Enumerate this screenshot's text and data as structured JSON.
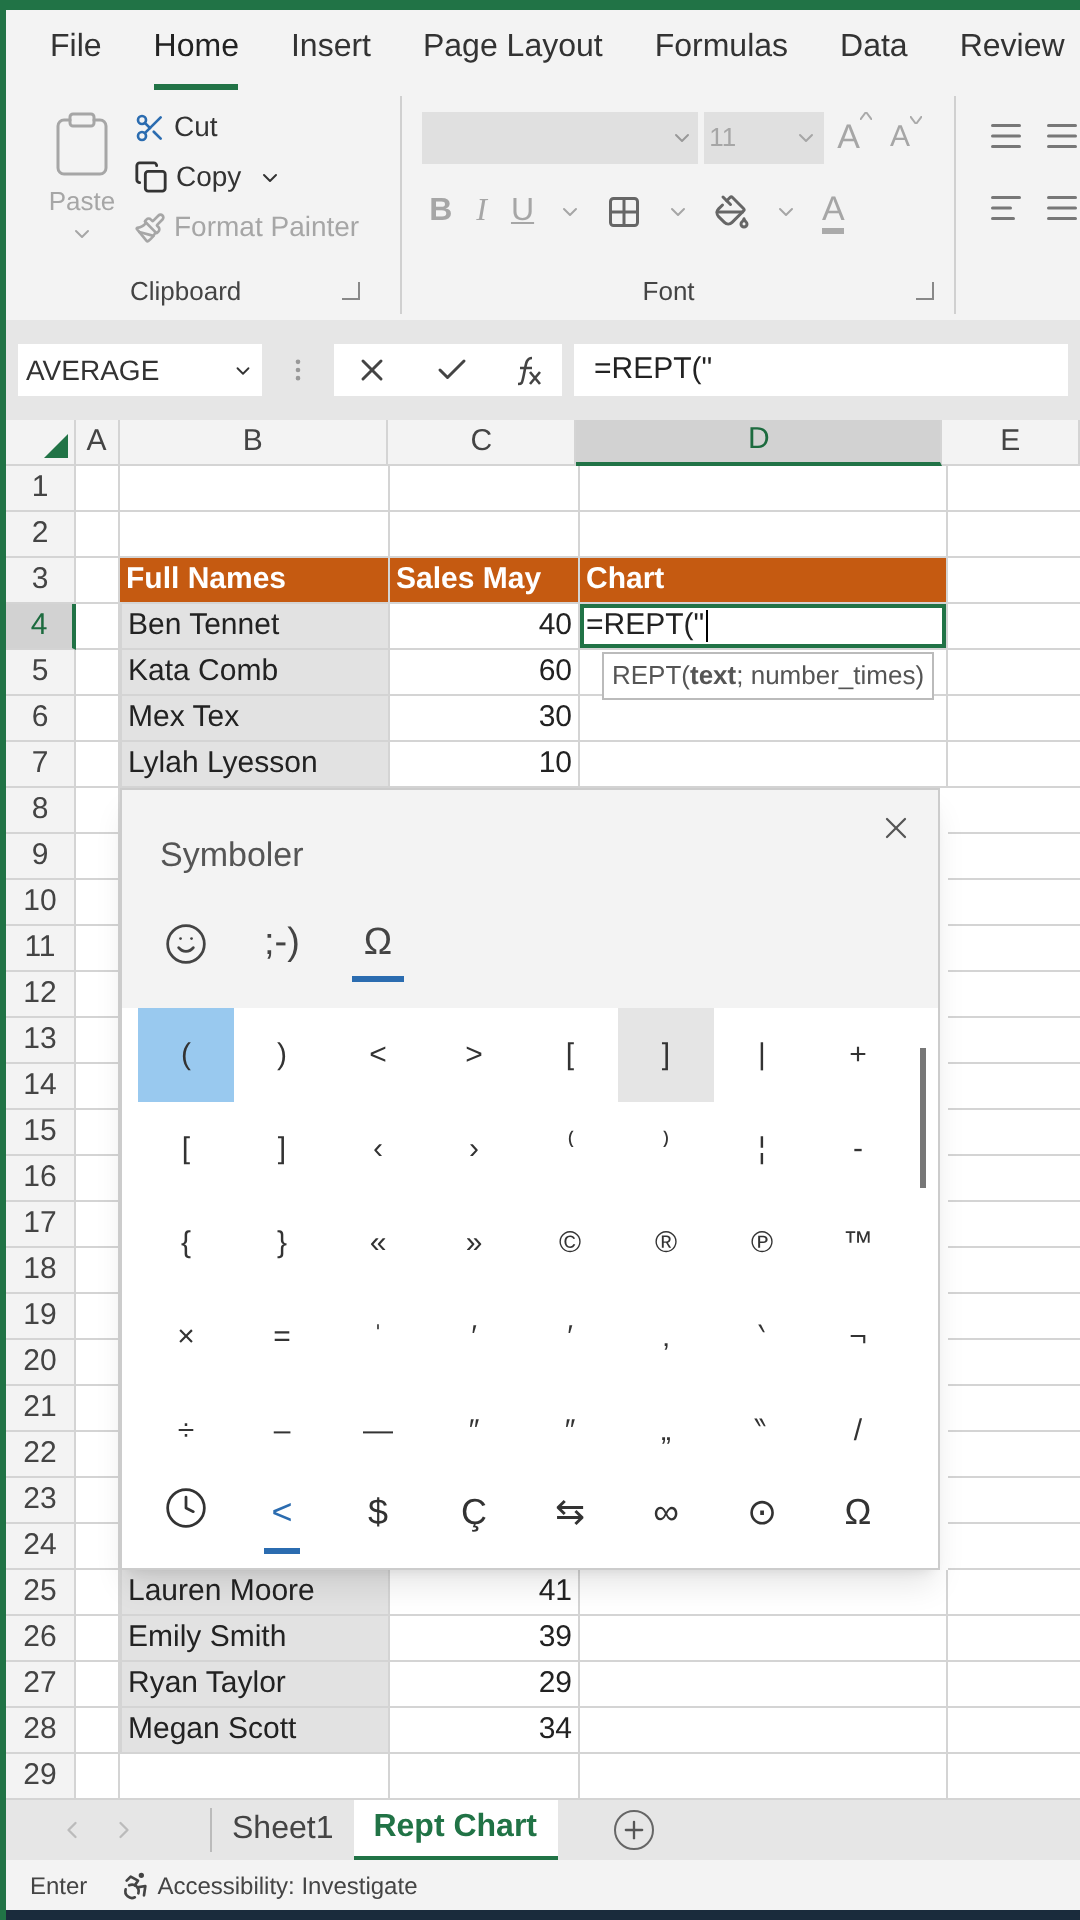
{
  "ribbon_tabs": [
    {
      "label": "File",
      "selected": false
    },
    {
      "label": "Home",
      "selected": true
    },
    {
      "label": "Insert",
      "selected": false
    },
    {
      "label": "Page Layout",
      "selected": false
    },
    {
      "label": "Formulas",
      "selected": false
    },
    {
      "label": "Data",
      "selected": false
    },
    {
      "label": "Review",
      "selected": false
    }
  ],
  "clipboard": {
    "disabled": true,
    "paste": "Paste",
    "cut": "Cut",
    "copy": "Copy",
    "format_painter": "Format Painter",
    "group_label": "Clipboard"
  },
  "font": {
    "disabled": true,
    "size": "11",
    "grow": "A",
    "shrink": "A",
    "bold": "B",
    "italic": "I",
    "underline": "U",
    "font_color": "A",
    "group_label": "Font"
  },
  "formula_bar": {
    "name_box": "AVERAGE",
    "formula": "=REPT(\""
  },
  "columns": [
    {
      "label": "A",
      "selected": false
    },
    {
      "label": "B",
      "selected": false
    },
    {
      "label": "C",
      "selected": false
    },
    {
      "label": "D",
      "selected": true
    },
    {
      "label": "E",
      "selected": false
    }
  ],
  "rows": [
    {
      "number": "1",
      "selected": false
    },
    {
      "number": "2",
      "selected": false
    },
    {
      "number": "3",
      "selected": false,
      "kind": "header",
      "name": "Full Names",
      "sales": "Sales May",
      "chart": "Chart"
    },
    {
      "number": "4",
      "selected": true,
      "kind": "data",
      "name": "Ben Tennet",
      "sales": "40",
      "chart": "=REPT(\"",
      "active": true
    },
    {
      "number": "5",
      "selected": false,
      "kind": "data",
      "name": "Kata Comb",
      "sales": "60"
    },
    {
      "number": "6",
      "selected": false,
      "kind": "data",
      "name": "Mex Tex",
      "sales": "30"
    },
    {
      "number": "7",
      "selected": false,
      "kind": "data",
      "name": "Lylah Lyesson",
      "sales": "10"
    },
    {
      "number": "8",
      "selected": false
    },
    {
      "number": "9",
      "selected": false
    },
    {
      "number": "10",
      "selected": false
    },
    {
      "number": "11",
      "selected": false
    },
    {
      "number": "12",
      "selected": false
    },
    {
      "number": "13",
      "selected": false
    },
    {
      "number": "14",
      "selected": false
    },
    {
      "number": "15",
      "selected": false
    },
    {
      "number": "16",
      "selected": false
    },
    {
      "number": "17",
      "selected": false
    },
    {
      "number": "18",
      "selected": false
    },
    {
      "number": "19",
      "selected": false
    },
    {
      "number": "20",
      "selected": false
    },
    {
      "number": "21",
      "selected": false
    },
    {
      "number": "22",
      "selected": false
    },
    {
      "number": "23",
      "selected": false
    },
    {
      "number": "24",
      "selected": false
    },
    {
      "number": "25",
      "selected": false,
      "kind": "data",
      "name": "Lauren Moore",
      "sales": "41"
    },
    {
      "number": "26",
      "selected": false,
      "kind": "data",
      "name": "Emily Smith",
      "sales": "39"
    },
    {
      "number": "27",
      "selected": false,
      "kind": "data",
      "name": "Ryan Taylor",
      "sales": "29"
    },
    {
      "number": "28",
      "selected": false,
      "kind": "data",
      "name": "Megan Scott",
      "sales": "34"
    },
    {
      "number": "29",
      "selected": false
    }
  ],
  "tooltip": "REPT(**text**; number_times)",
  "symbol_dialog": {
    "title": "Symboler",
    "tabs": [
      {
        "kind": "smiley",
        "selected": false
      },
      {
        "kind": "text",
        "label": ";-)",
        "selected": false
      },
      {
        "kind": "text",
        "label": "Ω",
        "selected": true
      }
    ],
    "symbols": [
      [
        {
          "s": "(",
          "selected": true,
          "hovered": false
        },
        {
          "s": ")",
          "selected": false,
          "hovered": false
        },
        {
          "s": "<",
          "selected": false,
          "hovered": false
        },
        {
          "s": ">",
          "selected": false,
          "hovered": false
        },
        {
          "s": "[",
          "selected": false,
          "hovered": false
        },
        {
          "s": "]",
          "selected": false,
          "hovered": true
        },
        {
          "s": "|",
          "selected": false,
          "hovered": false
        },
        {
          "s": "+",
          "selected": false,
          "hovered": false
        }
      ],
      [
        {
          "s": "[",
          "selected": false,
          "hovered": false
        },
        {
          "s": "]",
          "selected": false,
          "hovered": false
        },
        {
          "s": "‹",
          "selected": false,
          "hovered": false
        },
        {
          "s": "›",
          "selected": false,
          "hovered": false
        },
        {
          "s": "⁽",
          "selected": false,
          "hovered": false
        },
        {
          "s": "⁾",
          "selected": false,
          "hovered": false
        },
        {
          "s": "¦",
          "selected": false,
          "hovered": false
        },
        {
          "s": "-",
          "selected": false,
          "hovered": false
        }
      ],
      [
        {
          "s": "{",
          "selected": false,
          "hovered": false
        },
        {
          "s": "}",
          "selected": false,
          "hovered": false
        },
        {
          "s": "«",
          "selected": false,
          "hovered": false
        },
        {
          "s": "»",
          "selected": false,
          "hovered": false
        },
        {
          "s": "©",
          "selected": false,
          "hovered": false
        },
        {
          "s": "®",
          "selected": false,
          "hovered": false
        },
        {
          "s": "℗",
          "selected": false,
          "hovered": false
        },
        {
          "s": "™",
          "selected": false,
          "hovered": false
        }
      ],
      [
        {
          "s": "×",
          "selected": false,
          "hovered": false
        },
        {
          "s": "=",
          "selected": false,
          "hovered": false
        },
        {
          "s": "ˈ",
          "selected": false,
          "hovered": false
        },
        {
          "s": "′",
          "selected": false,
          "hovered": false
        },
        {
          "s": "′",
          "selected": false,
          "hovered": false
        },
        {
          "s": "‚",
          "selected": false,
          "hovered": false
        },
        {
          "s": "‵",
          "selected": false,
          "hovered": false
        },
        {
          "s": "¬",
          "selected": false,
          "hovered": false
        }
      ],
      [
        {
          "s": "÷",
          "selected": false,
          "hovered": false
        },
        {
          "s": "–",
          "selected": false,
          "hovered": false
        },
        {
          "s": "—",
          "selected": false,
          "hovered": false
        },
        {
          "s": "″",
          "selected": false,
          "hovered": false
        },
        {
          "s": "″",
          "selected": false,
          "hovered": false
        },
        {
          "s": "„",
          "selected": false,
          "hovered": false
        },
        {
          "s": "‶",
          "selected": false,
          "hovered": false
        },
        {
          "s": "/",
          "selected": false,
          "hovered": false
        }
      ]
    ],
    "categories": [
      {
        "kind": "clock",
        "selected": false
      },
      {
        "kind": "text",
        "label": "<",
        "selected": true
      },
      {
        "kind": "text",
        "label": "$",
        "selected": false
      },
      {
        "kind": "text",
        "label": "Ç",
        "selected": false
      },
      {
        "kind": "text",
        "label": "⇆",
        "selected": false
      },
      {
        "kind": "text",
        "label": "∞",
        "selected": false
      },
      {
        "kind": "text",
        "label": "⊙",
        "selected": false
      },
      {
        "kind": "text",
        "label": "Ω",
        "selected": false
      }
    ]
  },
  "sheet_tabs": [
    {
      "label": "Sheet1",
      "selected": false
    },
    {
      "label": "Rept Chart",
      "selected": true
    }
  ],
  "status_bar": {
    "mode": "Enter",
    "accessibility": "Accessibility: Investigate"
  }
}
